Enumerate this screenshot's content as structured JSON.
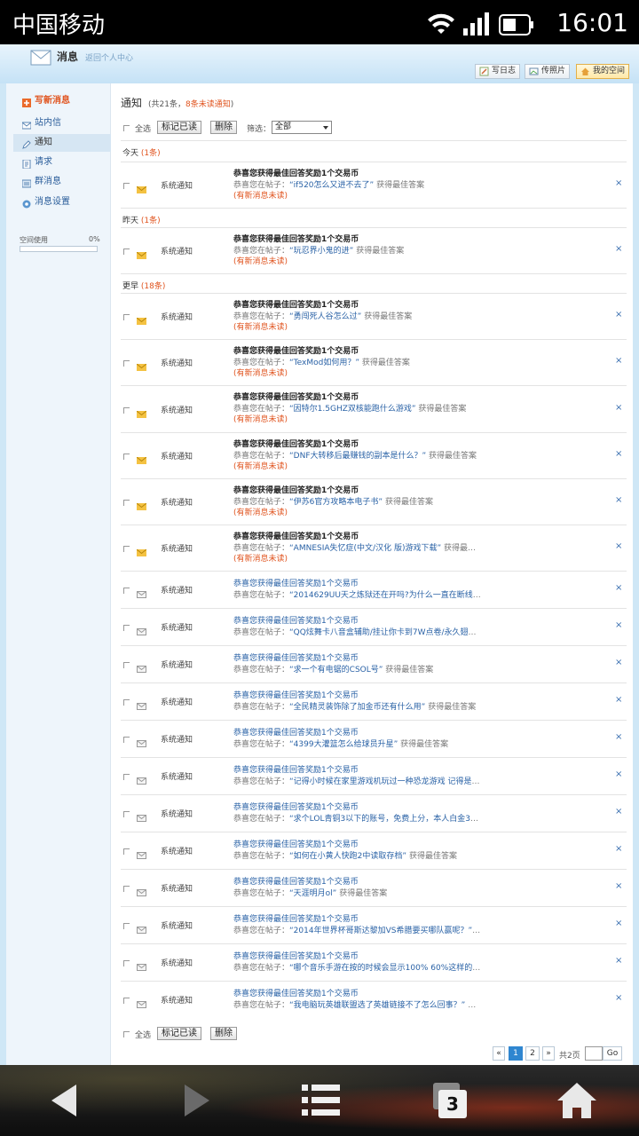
{
  "statusbar": {
    "carrier": "中国移动",
    "time": "16:01"
  },
  "header": {
    "title": "消息",
    "subtitle": "返回个人中心",
    "buttons": {
      "blog": "写日志",
      "photo": "传照片",
      "home": "我的空间"
    }
  },
  "sidebar": {
    "compose": "写新消息",
    "items": [
      "站内信",
      "通知",
      "请求",
      "群消息",
      "消息设置"
    ],
    "space_label": "空间使用",
    "space_pct": "0%",
    "space_fraction": 0
  },
  "main": {
    "title": "通知",
    "count_prefix": "(共21条，",
    "count_unread": "8条未读通知",
    "count_suffix": ")",
    "select_all": "全选",
    "mark_read": "标记已读",
    "delete": "删除",
    "filter_label": "筛选：",
    "filter_value": "全部"
  },
  "groups": {
    "today": {
      "label": "今天",
      "count": "(1条)"
    },
    "yesterday": {
      "label": "昨天",
      "count": "(1条)"
    },
    "earlier": {
      "label": "更早",
      "count": "(18条)"
    }
  },
  "common": {
    "type": "系统通知",
    "title": "恭喜您获得最佳回答奖励1个交易币",
    "body_prefix": "恭喜您在帖子：",
    "unread_note": "(有新消息未读)",
    "close": "×"
  },
  "rows": [
    {
      "q": "“if520怎么又进不去了”",
      "tail": " 获得最佳答案",
      "unread": true
    },
    {
      "q": "“玩忍界小鬼的进”",
      "tail": " 获得最佳答案",
      "unread": true
    },
    {
      "q": "“勇闯死人谷怎么过”",
      "tail": " 获得最佳答案",
      "unread": true
    },
    {
      "q": "“TexMod如何用？”",
      "tail": " 获得最佳答案",
      "unread": true
    },
    {
      "q": "“因特尔1.5GHZ双核能跑什么游戏”",
      "tail": " 获得最佳答案",
      "unread": true
    },
    {
      "q": "“DNF大转移后最赚钱的副本是什么？”",
      "tail": " 获得最佳答案",
      "unread": true
    },
    {
      "q": "“伊苏6官方攻略本电子书”",
      "tail": " 获得最佳答案",
      "unread": true
    },
    {
      "q": "“AMNESIA失忆症(中文/汉化 版)游戏下载”",
      "tail": " 获得最佳答案",
      "unread": true
    },
    {
      "q": "“2014629UU天之炼狱还在开吗?为什么一直在断线”",
      "tail": " 获...",
      "unread": false
    },
    {
      "q": "“QQ炫舞卡八音盒辅助/挂让你卡到7W点卷/永久翅膀/...",
      "tail": "",
      "unread": false
    },
    {
      "q": "“求一个有电锯的CSOL号”",
      "tail": " 获得最佳答案",
      "unread": false
    },
    {
      "q": "“全民精灵装饰除了加金币还有什么用”",
      "tail": " 获得最佳答案",
      "unread": false
    },
    {
      "q": "“4399大灌篮怎么给球员升星”",
      "tail": " 获得最佳答案",
      "unread": false
    },
    {
      "q": "“记得小时候在家里游戏机玩过一种恐龙游戏 记得是可...",
      "tail": "",
      "unread": false
    },
    {
      "q": "“求个LOL青铜3以下的账号，免费上分，本人白金3只...",
      "tail": "",
      "unread": false
    },
    {
      "q": "“如何在小黄人快跑2中读取存档”",
      "tail": " 获得最佳答案",
      "unread": false
    },
    {
      "q": "“天涯明月ol”",
      "tail": " 获得最佳答案",
      "unread": false
    },
    {
      "q": "“2014年世界杯哥斯达黎加VS希腊要买哪队赢呢？”",
      "tail": " 获...",
      "unread": false
    },
    {
      "q": "“哪个音乐手游在按的时候会显示100% 60%这样的？连...",
      "tail": "",
      "unread": false
    },
    {
      "q": "“我电脑玩英雄联盟选了英雄链接不了怎么回事？”",
      "tail": " 获...",
      "unread": false
    }
  ],
  "pager": {
    "prev": "«",
    "page1": "1",
    "page2": "2",
    "next": "»",
    "total": "共2页",
    "go": "Go"
  },
  "nav": {
    "tabs_count": "3"
  }
}
